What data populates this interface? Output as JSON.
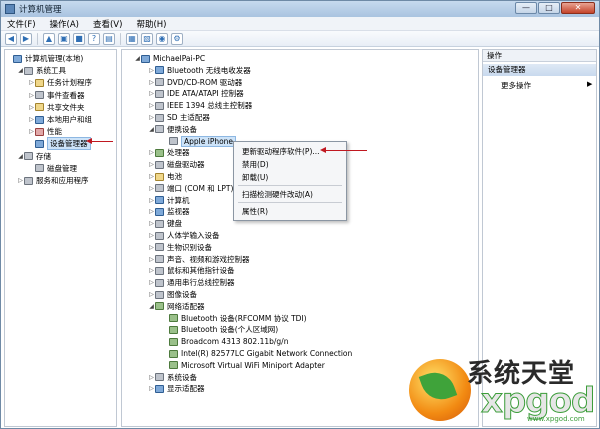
{
  "window": {
    "title": "计算机管理",
    "min": "—",
    "max": "□",
    "close": "✕"
  },
  "menu": [
    "文件(F)",
    "操作(A)",
    "查看(V)",
    "帮助(H)"
  ],
  "toolbar": [
    "◀",
    "▶",
    "▲",
    "▣",
    "■",
    "?",
    "▤",
    "▦",
    "▧",
    "◉",
    "⚙"
  ],
  "left_tree": [
    {
      "label": "计算机管理(本地)",
      "exp": "",
      "icon": "b",
      "indent": 0
    },
    {
      "label": "系统工具",
      "exp": "◢",
      "icon": "gr",
      "indent": 1
    },
    {
      "label": "任务计划程序",
      "exp": "▷",
      "icon": "y",
      "indent": 2
    },
    {
      "label": "事件查看器",
      "exp": "▷",
      "icon": "gr",
      "indent": 2
    },
    {
      "label": "共享文件夹",
      "exp": "▷",
      "icon": "y",
      "indent": 2
    },
    {
      "label": "本地用户和组",
      "exp": "▷",
      "icon": "b",
      "indent": 2
    },
    {
      "label": "性能",
      "exp": "▷",
      "icon": "r",
      "indent": 2
    },
    {
      "label": "设备管理器",
      "exp": "",
      "icon": "b",
      "indent": 2
    },
    {
      "label": "存储",
      "exp": "◢",
      "icon": "gr",
      "indent": 1
    },
    {
      "label": "磁盘管理",
      "exp": "",
      "icon": "gr",
      "indent": 2
    },
    {
      "label": "服务和应用程序",
      "exp": "▷",
      "icon": "gr",
      "indent": 1
    }
  ],
  "device_tree": [
    {
      "label": "MichaelPai-PC",
      "exp": "◢",
      "icon": "b",
      "indent": 0
    },
    {
      "label": "Bluetooth 无线电收发器",
      "exp": "▷",
      "icon": "b",
      "indent": 1
    },
    {
      "label": "DVD/CD-ROM 驱动器",
      "exp": "▷",
      "icon": "gr",
      "indent": 1
    },
    {
      "label": "IDE ATA/ATAPI 控制器",
      "exp": "▷",
      "icon": "gr",
      "indent": 1
    },
    {
      "label": "IEEE 1394 总线主控制器",
      "exp": "▷",
      "icon": "gr",
      "indent": 1
    },
    {
      "label": "SD 主适配器",
      "exp": "▷",
      "icon": "gr",
      "indent": 1
    },
    {
      "label": "便携设备",
      "exp": "◢",
      "icon": "gr",
      "indent": 1
    },
    {
      "label": "Apple iPhone",
      "exp": "",
      "icon": "gr",
      "indent": 2
    },
    {
      "label": "处理器",
      "exp": "▷",
      "icon": "g",
      "indent": 1
    },
    {
      "label": "磁盘驱动器",
      "exp": "▷",
      "icon": "gr",
      "indent": 1
    },
    {
      "label": "电池",
      "exp": "▷",
      "icon": "y",
      "indent": 1
    },
    {
      "label": "端口 (COM 和 LPT)",
      "exp": "▷",
      "icon": "gr",
      "indent": 1
    },
    {
      "label": "计算机",
      "exp": "▷",
      "icon": "b",
      "indent": 1
    },
    {
      "label": "监视器",
      "exp": "▷",
      "icon": "b",
      "indent": 1
    },
    {
      "label": "键盘",
      "exp": "▷",
      "icon": "gr",
      "indent": 1
    },
    {
      "label": "人体学输入设备",
      "exp": "▷",
      "icon": "gr",
      "indent": 1
    },
    {
      "label": "生物识别设备",
      "exp": "▷",
      "icon": "gr",
      "indent": 1
    },
    {
      "label": "声音、视频和游戏控制器",
      "exp": "▷",
      "icon": "gr",
      "indent": 1
    },
    {
      "label": "鼠标和其他指针设备",
      "exp": "▷",
      "icon": "gr",
      "indent": 1
    },
    {
      "label": "通用串行总线控制器",
      "exp": "▷",
      "icon": "gr",
      "indent": 1
    },
    {
      "label": "图像设备",
      "exp": "▷",
      "icon": "gr",
      "indent": 1
    },
    {
      "label": "网络适配器",
      "exp": "◢",
      "icon": "g",
      "indent": 1
    },
    {
      "label": "Bluetooth 设备(RFCOMM 协议 TDI)",
      "exp": "",
      "icon": "g",
      "indent": 2
    },
    {
      "label": "Bluetooth 设备(个人区域网)",
      "exp": "",
      "icon": "g",
      "indent": 2
    },
    {
      "label": "Broadcom 4313 802.11b/g/n",
      "exp": "",
      "icon": "g",
      "indent": 2
    },
    {
      "label": "Intel(R) 82577LC Gigabit Network Connection",
      "exp": "",
      "icon": "g",
      "indent": 2
    },
    {
      "label": "Microsoft Virtual WiFi Miniport Adapter",
      "exp": "",
      "icon": "g",
      "indent": 2
    },
    {
      "label": "系统设备",
      "exp": "▷",
      "icon": "gr",
      "indent": 1
    },
    {
      "label": "显示适配器",
      "exp": "▷",
      "icon": "b",
      "indent": 1
    }
  ],
  "context_menu": {
    "update": "更新驱动程序软件(P)...",
    "disable": "禁用(D)",
    "uninstall": "卸载(U)",
    "scan": "扫描检测硬件改动(A)",
    "properties": "属性(R)"
  },
  "actions": {
    "header": "操作",
    "selected": "设备管理器",
    "more": "更多操作",
    "more_arrow": "▶"
  },
  "watermark": {
    "cn": "系统天堂",
    "en": "xpgod",
    "url": "www.xpgod.com"
  }
}
